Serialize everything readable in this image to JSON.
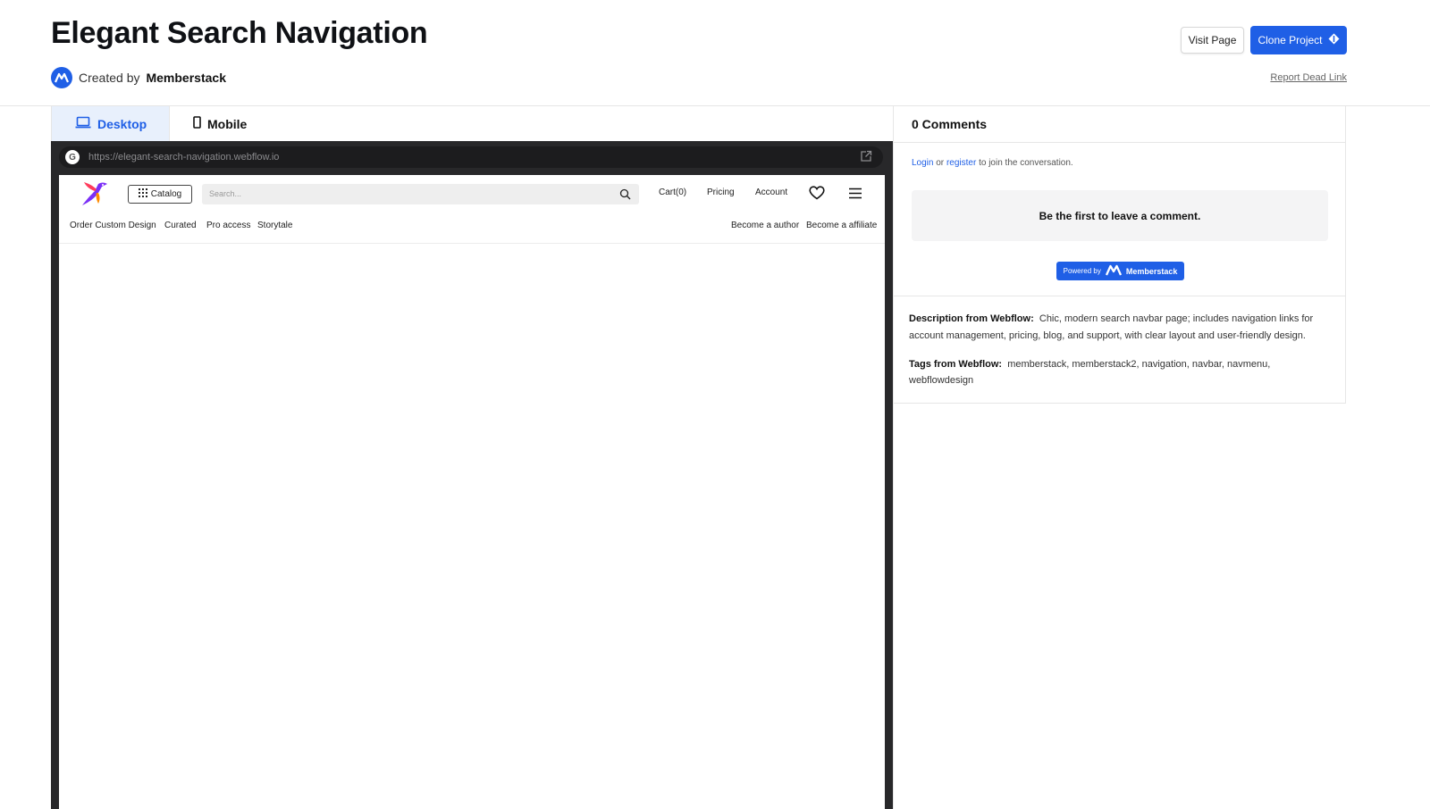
{
  "header": {
    "title": "Elegant Search Navigation",
    "created_prefix": "Created by",
    "creator": "Memberstack",
    "visit_label": "Visit Page",
    "clone_label": "Clone Project",
    "report_label": "Report Dead Link"
  },
  "tabs": [
    {
      "label": "Desktop",
      "icon": "laptop-icon",
      "active": true
    },
    {
      "label": "Mobile",
      "icon": "phone-icon",
      "active": false
    }
  ],
  "preview": {
    "url": "https://elegant-search-navigation.webflow.io",
    "catalog_label": "Catalog",
    "search_placeholder": "Search...",
    "nav": [
      "Cart(0)",
      "Pricing",
      "Account"
    ],
    "sub_left": [
      "Order Custom Design",
      "Curated",
      "Pro access",
      "Storytale"
    ],
    "sub_right": [
      "Become a author",
      "Become a affiliate"
    ]
  },
  "comments": {
    "heading": "0 Comments",
    "login": "Login",
    "or": "or",
    "register": "register",
    "join_suffix": "to join the conversation.",
    "empty": "Be the first to leave a comment.",
    "powered_by": "Powered by",
    "brand": "Memberstack"
  },
  "details": {
    "desc_label": "Description from Webflow:",
    "desc_text": "Chic, modern search navbar page; includes navigation links for account management, pricing, blog, and support, with clear layout and user-friendly design.",
    "tags_label": "Tags from Webflow:",
    "tags_text": "memberstack, memberstack2, navigation, navbar, navmenu, webflowdesign"
  },
  "colors": {
    "accent": "#1f5fe6",
    "frame": "#28282a"
  }
}
